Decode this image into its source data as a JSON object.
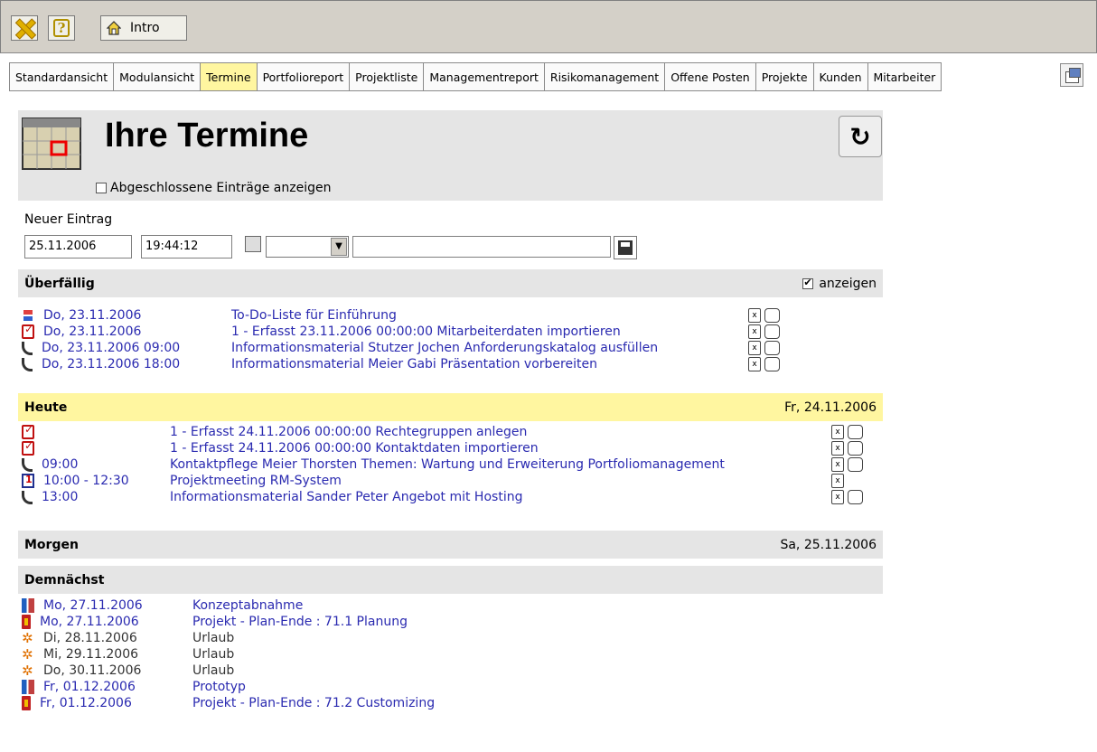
{
  "toolbar": {
    "intro_label": "Intro"
  },
  "tabs": [
    {
      "label": "Standardansicht",
      "active": false
    },
    {
      "label": "Modulansicht",
      "active": false
    },
    {
      "label": "Termine",
      "active": true
    },
    {
      "label": "Portfolioreport",
      "active": false
    },
    {
      "label": "Projektliste",
      "active": false
    },
    {
      "label": "Managementreport",
      "active": false
    },
    {
      "label": "Risikomanagement",
      "active": false
    },
    {
      "label": "Offene Posten",
      "active": false
    },
    {
      "label": "Projekte",
      "active": false
    },
    {
      "label": "Kunden",
      "active": false
    },
    {
      "label": "Mitarbeiter",
      "active": false
    }
  ],
  "header": {
    "title": "Ihre Termine",
    "show_completed_label": "Abgeschlossene Einträge anzeigen",
    "show_completed_checked": false
  },
  "new_entry": {
    "label": "Neuer Eintrag",
    "date": "25.11.2006",
    "time": "19:44:12",
    "type_value": "",
    "text_value": ""
  },
  "overdue": {
    "title": "Überfällig",
    "show_label": "anzeigen",
    "show_checked": true,
    "items": [
      {
        "icon": "todo-list-icon",
        "date": "Do, 23.11.2006",
        "title": "To-Do-Liste für Einführung"
      },
      {
        "icon": "task-check-icon",
        "date": "Do, 23.11.2006",
        "title": "1 - Erfasst 23.11.2006 00:00:00 Mitarbeiterdaten importieren"
      },
      {
        "icon": "phone-icon",
        "date": "Do, 23.11.2006 09:00",
        "title": "Informationsmaterial Stutzer Jochen Anforderungskatalog ausfüllen"
      },
      {
        "icon": "phone-icon",
        "date": "Do, 23.11.2006 18:00",
        "title": "Informationsmaterial Meier Gabi Präsentation vorbereiten"
      }
    ]
  },
  "today": {
    "title": "Heute",
    "date": "Fr, 24.11.2006",
    "items": [
      {
        "icon": "task-check-icon",
        "time": "",
        "title": "1 - Erfasst 24.11.2006 00:00:00 Rechtegruppen anlegen",
        "checkbox": true
      },
      {
        "icon": "task-check-icon",
        "time": "",
        "title": "1 - Erfasst 24.11.2006 00:00:00 Kontaktdaten importieren",
        "checkbox": true
      },
      {
        "icon": "phone-icon",
        "time": "09:00",
        "title": "Kontaktpflege Meier Thorsten Themen: Wartung und Erweiterung Portfoliomanagement",
        "checkbox": true
      },
      {
        "icon": "calendar-icon",
        "time": "10:00 - 12:30",
        "title": "Projektmeeting RM-System",
        "checkbox": false
      },
      {
        "icon": "phone-icon",
        "time": "13:00",
        "title": "Informationsmaterial Sander Peter Angebot mit Hosting",
        "checkbox": true
      }
    ]
  },
  "tomorrow": {
    "title": "Morgen",
    "date": "Sa, 25.11.2006"
  },
  "upcoming": {
    "title": "Demnächst",
    "items": [
      {
        "icon": "milestone-icon",
        "date": "Mo, 27.11.2006",
        "title": "Konzeptabnahme",
        "link": true
      },
      {
        "icon": "project-end-icon",
        "date": "Mo, 27.11.2006",
        "title": "Projekt - Plan-Ende : 71.1 Planung",
        "link": true
      },
      {
        "icon": "vacation-icon",
        "date": "Di, 28.11.2006",
        "title": "Urlaub",
        "link": false
      },
      {
        "icon": "vacation-icon",
        "date": "Mi, 29.11.2006",
        "title": "Urlaub",
        "link": false
      },
      {
        "icon": "vacation-icon",
        "date": "Do, 30.11.2006",
        "title": "Urlaub",
        "link": false
      },
      {
        "icon": "milestone-icon",
        "date": "Fr, 01.12.2006",
        "title": "Prototyp",
        "link": true
      },
      {
        "icon": "project-end-icon",
        "date": "Fr, 01.12.2006",
        "title": "Projekt - Plan-Ende : 71.2 Customizing",
        "link": true
      }
    ]
  }
}
